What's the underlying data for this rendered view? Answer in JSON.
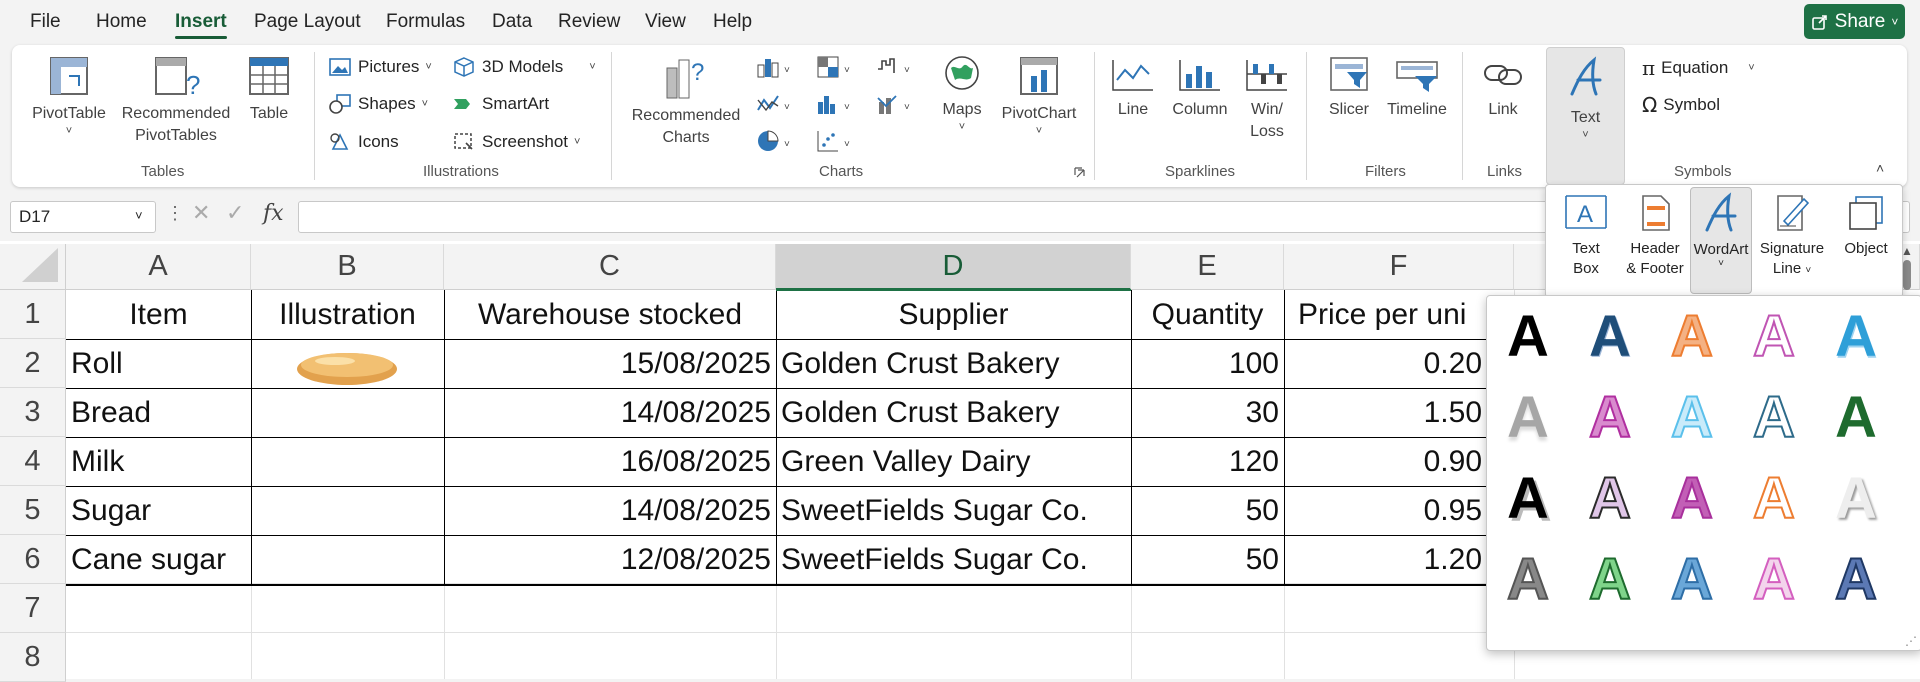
{
  "menu": {
    "items": [
      "File",
      "Home",
      "Insert",
      "Page Layout",
      "Formulas",
      "Data",
      "Review",
      "View",
      "Help"
    ],
    "active": "Insert",
    "share_label": "Share"
  },
  "ribbon": {
    "tables": {
      "group_label": "Tables",
      "pivot_table": "PivotTable",
      "recommended_pivot_1": "Recommended",
      "recommended_pivot_2": "PivotTables",
      "table": "Table"
    },
    "illustrations": {
      "group_label": "Illustrations",
      "pictures": "Pictures",
      "shapes": "Shapes",
      "icons": "Icons",
      "models_3d": "3D Models",
      "smartart": "SmartArt",
      "screenshot": "Screenshot"
    },
    "charts": {
      "group_label": "Charts",
      "recommended_1": "Recommended",
      "recommended_2": "Charts",
      "maps": "Maps",
      "pivot_chart": "PivotChart"
    },
    "sparklines": {
      "group_label": "Sparklines",
      "line": "Line",
      "column": "Column",
      "winloss_1": "Win/",
      "winloss_2": "Loss"
    },
    "filters": {
      "group_label": "Filters",
      "slicer": "Slicer",
      "timeline": "Timeline"
    },
    "links": {
      "group_label": "Links",
      "link": "Link"
    },
    "text": {
      "label": "Text"
    },
    "symbols": {
      "group_label": "Symbols",
      "equation": "Equation",
      "symbol": "Symbol"
    }
  },
  "formula_bar": {
    "name_box": "D17",
    "fx": "fx",
    "content": ""
  },
  "text_dropdown": {
    "text_box_1": "Text",
    "text_box_2": "Box",
    "header_footer_1": "Header",
    "header_footer_2": "& Footer",
    "wordart": "WordArt",
    "signature_1": "Signature",
    "signature_2": "Line",
    "object": "Object"
  },
  "grid": {
    "columns": [
      "A",
      "B",
      "C",
      "D",
      "E",
      "F"
    ],
    "selected_column": "D",
    "rows": [
      "1",
      "2",
      "3",
      "4",
      "5",
      "6",
      "7",
      "8"
    ],
    "headers": [
      "Item",
      "Illustration",
      "Warehouse stocked",
      "Supplier",
      "Quantity",
      "Price per uni"
    ],
    "data": [
      {
        "item": "Roll",
        "date": "15/08/2025",
        "supplier": "Golden Crust Bakery",
        "qty": "100",
        "price": "0.20"
      },
      {
        "item": "Bread",
        "date": "14/08/2025",
        "supplier": "Golden Crust Bakery",
        "qty": "30",
        "price": "1.50"
      },
      {
        "item": "Milk",
        "date": "16/08/2025",
        "supplier": "Green Valley Dairy",
        "qty": "120",
        "price": "0.90"
      },
      {
        "item": "Sugar",
        "date": "14/08/2025",
        "supplier": "SweetFields Sugar Co.",
        "qty": "50",
        "price": "0.95"
      },
      {
        "item": "Cane sugar",
        "date": "12/08/2025",
        "supplier": "SweetFields Sugar Co.",
        "qty": "50",
        "price": "1.20"
      }
    ]
  },
  "wordart_styles": {
    "glyph": "A",
    "colors": [
      "#000000",
      "#1f4e79",
      "#ed7d31",
      "#c055b3",
      "#2e9fd8",
      "#a6a6a6",
      "#b02fa0",
      "#5bc0eb",
      "#2e6b8a",
      "#1e6b2e",
      "#000000",
      "#2b2b2b",
      "#a8309c",
      "#ed7d31",
      "#d9d9d9",
      "#555555",
      "#2e9b3a",
      "#2e6ea6",
      "#d45fbf",
      "#1f3864"
    ]
  }
}
